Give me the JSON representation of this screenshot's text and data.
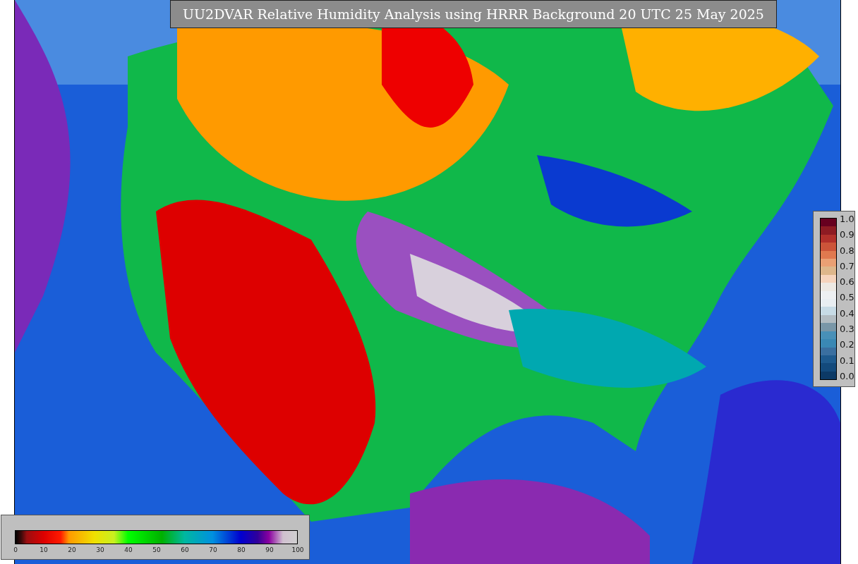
{
  "title": "UU2DVAR Relative Humidity Analysis using HRRR Background 20 UTC 25 May 2025",
  "humidity_colorbar": {
    "ticks": [
      "0",
      "10",
      "20",
      "30",
      "40",
      "50",
      "60",
      "70",
      "80",
      "90",
      "100"
    ]
  },
  "ratio_colorbar": {
    "ticks": [
      "1.0",
      "0.9",
      "0.8",
      "0.7",
      "0.6",
      "0.5",
      "0.4",
      "0.3",
      "0.2",
      "0.1",
      "0.0"
    ]
  }
}
